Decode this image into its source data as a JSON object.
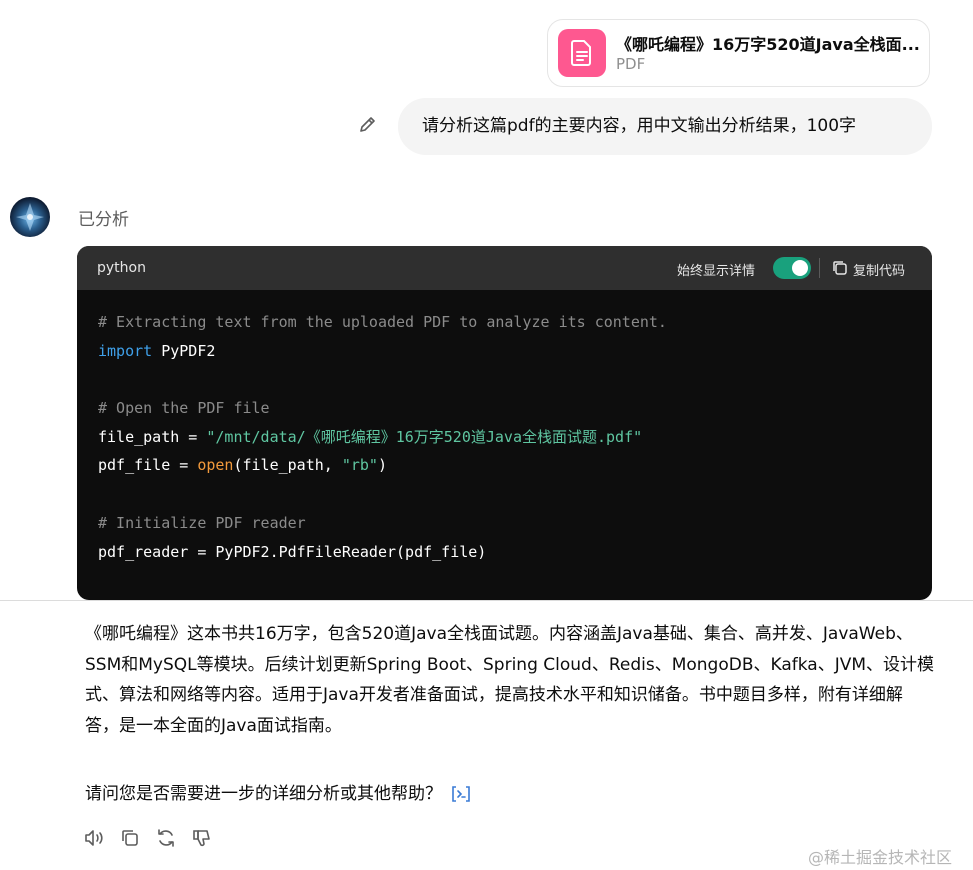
{
  "attachment": {
    "file_name": "《哪吒编程》16万字520道Java全栈面...",
    "file_type": "PDF",
    "icon": "document-icon",
    "icon_color": "#fe5890"
  },
  "user_message": {
    "text": "请分析这篇pdf的主要内容，用中文输出分析结果，100字",
    "edit_icon": "pencil-icon"
  },
  "assistant": {
    "status": "已分析",
    "code_block": {
      "language": "python",
      "toggle_label": "始终显示详情",
      "toggle_on": true,
      "copy_label": "复制代码",
      "lines": [
        [
          {
            "t": "comment",
            "v": "# Extracting text from the uploaded PDF to analyze its content."
          }
        ],
        [
          {
            "t": "keyword",
            "v": "import"
          },
          {
            "t": "plain",
            "v": " PyPDF2"
          }
        ],
        [],
        [
          {
            "t": "comment",
            "v": "# Open the PDF file"
          }
        ],
        [
          {
            "t": "plain",
            "v": "file_path = "
          },
          {
            "t": "string",
            "v": "\"/mnt/data/《哪吒编程》16万字520道Java全栈面试题.pdf\""
          }
        ],
        [
          {
            "t": "plain",
            "v": "pdf_file = "
          },
          {
            "t": "builtin",
            "v": "open"
          },
          {
            "t": "plain",
            "v": "(file_path, "
          },
          {
            "t": "string",
            "v": "\"rb\""
          },
          {
            "t": "plain",
            "v": ")"
          }
        ],
        [],
        [
          {
            "t": "comment",
            "v": "# Initialize PDF reader"
          }
        ],
        [
          {
            "t": "plain",
            "v": "pdf_reader = PyPDF2.PdfFileReader(pdf_file)"
          }
        ]
      ]
    },
    "answer": "《哪吒编程》这本书共16万字，包含520道Java全栈面试题。内容涵盖Java基础、集合、高并发、JavaWeb、SSM和MySQL等模块。后续计划更新Spring Boot、Spring Cloud、Redis、MongoDB、Kafka、JVM、设计模式、算法和网络等内容。适用于Java开发者准备面试，提高技术水平和知识储备。书中题目多样，附有详细解答，是一本全面的Java面试指南。",
    "followup": "请问您是否需要进一步的详细分析或其他帮助？",
    "actions": [
      "read-aloud-icon",
      "copy-icon",
      "regenerate-icon",
      "thumbs-down-icon"
    ]
  },
  "watermark": "@稀土掘金技术社区",
  "colors": {
    "code_bg": "#0d0d0d",
    "code_header_bg": "#2f2f2f",
    "toggle_on": "#19a17d",
    "keyword": "#3fa0e9",
    "string": "#5fc6a1",
    "builtin": "#f29a3c",
    "comment": "#8b8b8b"
  }
}
